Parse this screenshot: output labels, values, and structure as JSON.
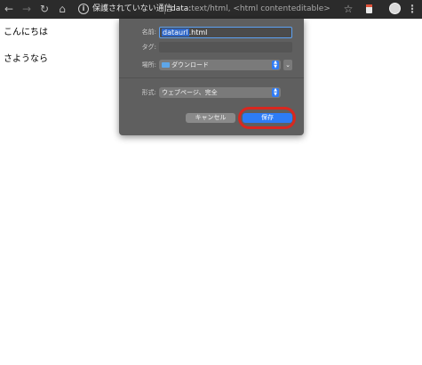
{
  "browser": {
    "security_label": "保護されていない通信",
    "url_scheme": "data:",
    "url_rest": "text/html, <html contenteditable>",
    "icons": [
      "back-icon",
      "forward-icon",
      "reload-icon",
      "home-icon",
      "info-icon",
      "star-icon",
      "extension-icon",
      "profile-avatar",
      "menu-icon"
    ]
  },
  "page": {
    "line1": "こんにちは",
    "line2": "さようなら"
  },
  "dialog": {
    "name_label": "名前:",
    "name_value_selected": "dataurl",
    "name_value_ext": ".html",
    "tag_label": "タグ:",
    "location_label": "場所:",
    "location_value": "ダウンロード",
    "format_label": "形式:",
    "format_value": "ウェブページ、完全",
    "cancel_label": "キャンセル",
    "save_label": "保存"
  },
  "colors": {
    "toolbar_bg": "#2b2b2b",
    "dialog_bg": "#5f5f5f",
    "save_button": "#2d7cf6",
    "highlight_ring": "#d9271f"
  }
}
